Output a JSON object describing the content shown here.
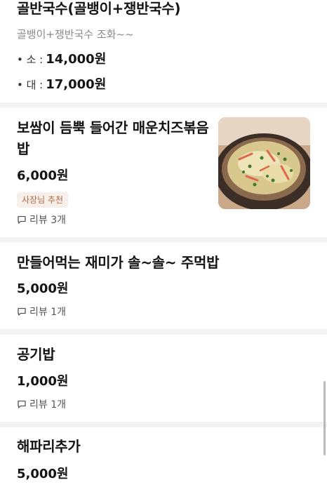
{
  "item_top": {
    "title": "골반국수(골뱅이+쟁반국수)",
    "description": "골뱅이+쟁반국수 조화~~",
    "options": [
      {
        "name": "• 소 :",
        "price": "14,000원"
      },
      {
        "name": "• 대 :",
        "price": "17,000원"
      }
    ]
  },
  "item_bossam": {
    "title_line1": "보쌈이 듬뿍 들어간 매운치즈볶음",
    "title_line2": "밥",
    "price": "6,000원",
    "badge": "사장님 추천",
    "review": "리뷰 3개",
    "image_icon": "food-photo"
  },
  "item_jumeokbap": {
    "title": "만들어먹는 재미가 솔~솔~ 주먹밥",
    "price": "5,000원",
    "review": "리뷰 1개"
  },
  "item_gonggibap": {
    "title": "공기밥",
    "price": "1,000원",
    "review": "리뷰 1개"
  },
  "item_haepari": {
    "title": "해파리추가",
    "price": "5,000원"
  },
  "icons": {
    "review": "speech-bubble-icon"
  },
  "colors": {
    "badge_bg": "#f7efe9",
    "badge_text": "#b26a43",
    "divider": "#f3f3f3"
  }
}
